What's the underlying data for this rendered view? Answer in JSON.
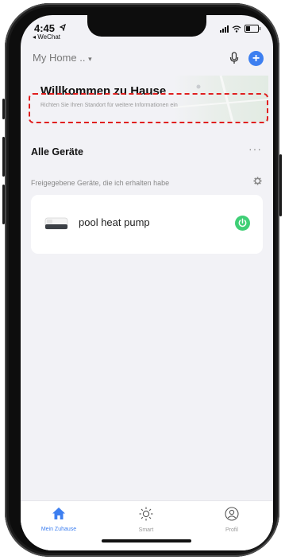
{
  "status": {
    "time": "4:45",
    "back_app": "◂ WeChat"
  },
  "header": {
    "home_name": "My Home ..",
    "home_caret": "▾",
    "add_symbol": "+"
  },
  "welcome": {
    "title": "Willkommen zu Hause",
    "subtitle": "Richten Sie Ihren Standort für weitere Informationen ein"
  },
  "devices": {
    "title": "Alle Geräte",
    "more": "···",
    "shared_label": "Freigegebene Geräte, die ich erhalten habe",
    "items": [
      {
        "name": "pool heat pump",
        "power_on": true
      }
    ]
  },
  "tabs": [
    {
      "label": "Mein Zuhause",
      "icon": "home-icon",
      "active": true
    },
    {
      "label": "Smart",
      "icon": "sun-icon",
      "active": false
    },
    {
      "label": "Profil",
      "icon": "profile-icon",
      "active": false
    }
  ],
  "colors": {
    "accent": "#3d7ff0",
    "power_on": "#3fcf76",
    "highlight_box": "#e01f1f"
  }
}
